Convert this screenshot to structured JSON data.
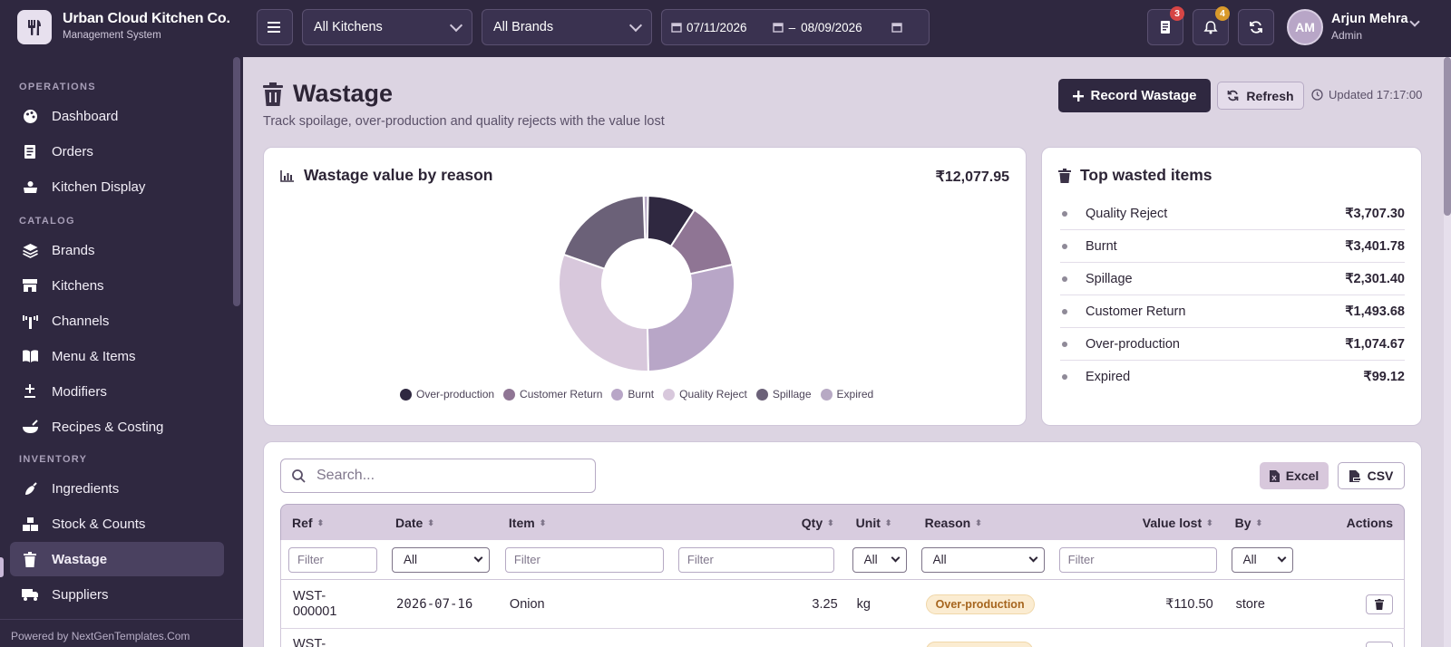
{
  "app": {
    "name": "Urban Cloud Kitchen Co.",
    "subtitle": "Management System"
  },
  "topbar": {
    "kitchen_select": "All Kitchens",
    "brand_select": "All Brands",
    "date_from": "07/11/2026",
    "date_sep": "–",
    "date_to": "08/09/2026",
    "orders_badge": "3",
    "notifications_badge": "4",
    "user": {
      "initials": "AM",
      "name": "Arjun Mehra",
      "role": "Admin"
    }
  },
  "sidebar": {
    "sections": [
      {
        "title": "OPERATIONS",
        "items": [
          {
            "label": "Dashboard",
            "icon": "palette-icon"
          },
          {
            "label": "Orders",
            "icon": "receipt-icon"
          },
          {
            "label": "Kitchen Display",
            "icon": "cooking-icon"
          }
        ]
      },
      {
        "title": "CATALOG",
        "items": [
          {
            "label": "Brands",
            "icon": "layers-icon"
          },
          {
            "label": "Kitchens",
            "icon": "store-icon"
          },
          {
            "label": "Channels",
            "icon": "antenna-icon"
          },
          {
            "label": "Menu & Items",
            "icon": "book-icon"
          },
          {
            "label": "Modifiers",
            "icon": "plus-minus-icon"
          },
          {
            "label": "Recipes & Costing",
            "icon": "bowl-icon"
          }
        ]
      },
      {
        "title": "INVENTORY",
        "items": [
          {
            "label": "Ingredients",
            "icon": "pepper-icon"
          },
          {
            "label": "Stock & Counts",
            "icon": "boxes-icon"
          },
          {
            "label": "Wastage",
            "icon": "trash-icon",
            "active": true
          },
          {
            "label": "Suppliers",
            "icon": "truck-icon"
          }
        ]
      }
    ],
    "footer": "Powered by NextGenTemplates.Com"
  },
  "page": {
    "title": "Wastage",
    "subtitle": "Track spoilage, over-production and quality rejects with the value lost",
    "record_button": "Record Wastage",
    "refresh_button": "Refresh",
    "updated": "Updated 17:17:00"
  },
  "chart_card": {
    "title": "Wastage value by reason",
    "total": "₹12,077.95"
  },
  "chart_data": {
    "type": "pie",
    "title": "Wastage value by reason",
    "labels": [
      "Over-production",
      "Customer Return",
      "Burnt",
      "Quality Reject",
      "Spillage",
      "Expired"
    ],
    "values": [
      1074.67,
      1493.68,
      3401.78,
      3707.3,
      2301.4,
      99.12
    ],
    "colors": [
      "#2f2840",
      "#8f7594",
      "#b8a6c7",
      "#d8c8dc",
      "#6b6178",
      "#b7a9c4"
    ],
    "legend": "bottom",
    "donut": true
  },
  "top_items": {
    "title": "Top wasted items",
    "items": [
      {
        "name": "Quality Reject",
        "value": "₹3,707.30"
      },
      {
        "name": "Burnt",
        "value": "₹3,401.78"
      },
      {
        "name": "Spillage",
        "value": "₹2,301.40"
      },
      {
        "name": "Customer Return",
        "value": "₹1,493.68"
      },
      {
        "name": "Over-production",
        "value": "₹1,074.67"
      },
      {
        "name": "Expired",
        "value": "₹99.12"
      }
    ]
  },
  "table": {
    "search_placeholder": "Search...",
    "excel": "Excel",
    "csv": "CSV",
    "columns": [
      "Ref",
      "Date",
      "Item",
      "Qty",
      "Unit",
      "Reason",
      "Value lost",
      "By",
      "Actions"
    ],
    "filter_placeholder": "Filter",
    "filter_all": "All",
    "rows": [
      {
        "ref": "WST-\n000001",
        "date": "2026-07-16",
        "item": "Onion",
        "qty": "3.25",
        "unit": "kg",
        "reason": "Over-production",
        "value": "₹110.50",
        "by": "store"
      },
      {
        "ref": "WST-",
        "date": "",
        "item": "",
        "qty": "",
        "unit": "",
        "reason": "",
        "value": "",
        "by": ""
      }
    ]
  }
}
